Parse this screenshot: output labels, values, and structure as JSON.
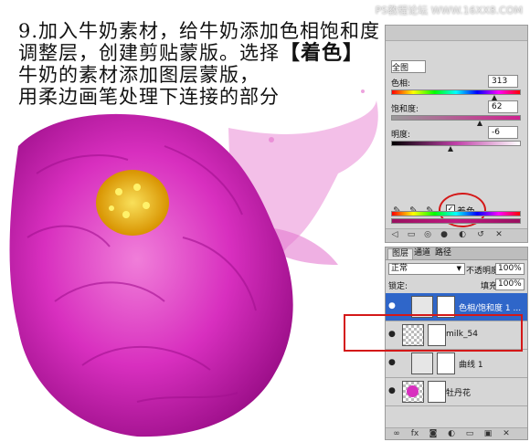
{
  "caption": {
    "line1": "9.加入牛奶素材，给牛奶添加色相饱和度",
    "line2_prefix": "调整层，创建剪贴蒙版。选择",
    "line2_highlight": "【着色】",
    "line3": "牛奶的素材添加图层蒙版，",
    "line4": "用柔边画笔处理下连接的部分"
  },
  "watermark": "PS教程论坛 WWW.16XX8.COM",
  "adjustments": {
    "preset_value": "全图",
    "hue_label": "色相:",
    "hue_value": "313",
    "saturation_label": "饱和度:",
    "saturation_value": "62",
    "lightness_label": "明度:",
    "lightness_value": "-6",
    "colorize_label": "着色",
    "colorize_checked": true
  },
  "layers_panel": {
    "tabs": [
      "图层",
      "通道",
      "路径"
    ],
    "blend_mode": "正常",
    "opacity_label": "不透明度:",
    "opacity_value": "100%",
    "lock_label": "锁定:",
    "fill_label": "填充:",
    "fill_value": "100%",
    "layers": [
      {
        "name": "色相/饱和度 1 ...",
        "selected": true
      },
      {
        "name": "milk_54",
        "selected": false
      },
      {
        "name": "曲线 1",
        "selected": false
      },
      {
        "name": "牡丹花",
        "selected": false
      }
    ]
  },
  "colors": {
    "flower_pink": "#e23fc4",
    "flower_center": "#f2c21a",
    "selection_blue": "#2f66c9",
    "highlight_red": "#d41818"
  }
}
